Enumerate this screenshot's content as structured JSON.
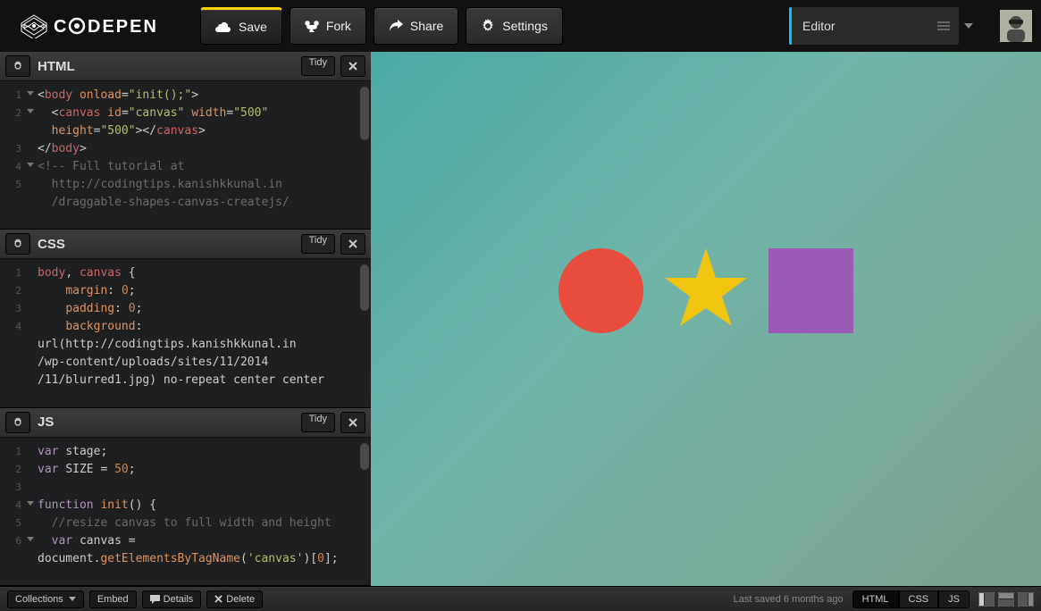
{
  "topbar": {
    "save": "Save",
    "fork": "Fork",
    "share": "Share",
    "settings": "Settings",
    "editor_label": "Editor"
  },
  "panes": {
    "html": {
      "title": "HTML",
      "tidy": "Tidy",
      "lines": [
        {
          "n": "1",
          "fold": true,
          "html": "<span class='t-punc'>&lt;</span><span class='t-tag'>body</span> <span class='t-attr'>onload</span><span class='t-punc'>=</span><span class='t-str'>\"init();\"</span><span class='t-punc'>&gt;</span>"
        },
        {
          "n": "2",
          "fold": true,
          "html": "  <span class='t-punc'>&lt;</span><span class='t-tag'>canvas</span> <span class='t-attr'>id</span><span class='t-punc'>=</span><span class='t-str'>\"canvas\"</span> <span class='t-attr'>width</span><span class='t-punc'>=</span><span class='t-str'>\"500\"</span>"
        },
        {
          "n": "",
          "html": "  <span class='t-attr'>height</span><span class='t-punc'>=</span><span class='t-str'>\"500\"</span><span class='t-punc'>&gt;&lt;/</span><span class='t-tag'>canvas</span><span class='t-punc'>&gt;</span>"
        },
        {
          "n": "3",
          "html": "<span class='t-punc'>&lt;/</span><span class='t-tag'>body</span><span class='t-punc'>&gt;</span>"
        },
        {
          "n": "4",
          "fold": true,
          "html": "<span class='t-com'>&lt;!-- Full tutorial at</span>"
        },
        {
          "n": "5",
          "html": "<span class='t-com'>  http://codingtips.kanishkkunal.in</span>"
        },
        {
          "n": "",
          "html": "<span class='t-com'>  /draggable-shapes-canvas-createjs/</span>"
        }
      ]
    },
    "css": {
      "title": "CSS",
      "tidy": "Tidy",
      "lines": [
        {
          "n": "1",
          "html": "<span class='t-sel'>body</span><span class='t-punc'>,</span> <span class='t-sel'>canvas</span> <span class='t-punc'>{</span>"
        },
        {
          "n": "2",
          "html": "    <span class='t-prop'>margin</span><span class='t-punc'>:</span> <span class='t-num'>0</span><span class='t-punc'>;</span>"
        },
        {
          "n": "3",
          "html": "    <span class='t-prop'>padding</span><span class='t-punc'>:</span> <span class='t-num'>0</span><span class='t-punc'>;</span>"
        },
        {
          "n": "4",
          "html": "    <span class='t-prop'>background</span><span class='t-punc'>:</span>"
        },
        {
          "n": "",
          "html": "<span class='t-var'>url(http://codingtips.kanishkkunal.in</span>"
        },
        {
          "n": "",
          "html": "<span class='t-var'>/wp-content/uploads/sites/11/2014</span>"
        },
        {
          "n": "",
          "html": "<span class='t-var'>/11/blurred1.jpg) no-repeat center center</span>"
        }
      ]
    },
    "js": {
      "title": "JS",
      "tidy": "Tidy",
      "lines": [
        {
          "n": "1",
          "html": "<span class='t-kw'>var</span> <span class='t-var'>stage</span><span class='t-punc'>;</span>"
        },
        {
          "n": "2",
          "html": "<span class='t-kw'>var</span> <span class='t-var'>SIZE</span> <span class='t-punc'>=</span> <span class='t-num'>50</span><span class='t-punc'>;</span>"
        },
        {
          "n": "3",
          "html": ""
        },
        {
          "n": "4",
          "fold": true,
          "html": "<span class='t-kw'>function</span> <span class='t-fn'>init</span><span class='t-punc'>() {</span>"
        },
        {
          "n": "5",
          "html": "  <span class='t-com'>//resize canvas to full width and height</span>"
        },
        {
          "n": "6",
          "fold": true,
          "html": "  <span class='t-kw'>var</span> <span class='t-var'>canvas</span> <span class='t-punc'>=</span>"
        },
        {
          "n": "",
          "html": "<span class='t-var'>document</span><span class='t-punc'>.</span><span class='t-fn'>getElementsByTagName</span><span class='t-punc'>(</span><span class='t-str'>'canvas'</span><span class='t-punc'>)[</span><span class='t-num'>0</span><span class='t-punc'>];</span>"
        }
      ]
    }
  },
  "preview": {
    "circle_color": "#e74c3c",
    "star_color": "#f1c40f",
    "square_color": "#9b59b6"
  },
  "bottombar": {
    "collections": "Collections",
    "embed": "Embed",
    "details": "Details",
    "delete": "Delete",
    "saved": "Last saved 6 months ago",
    "views": {
      "html": "HTML",
      "css": "CSS",
      "js": "JS"
    }
  }
}
